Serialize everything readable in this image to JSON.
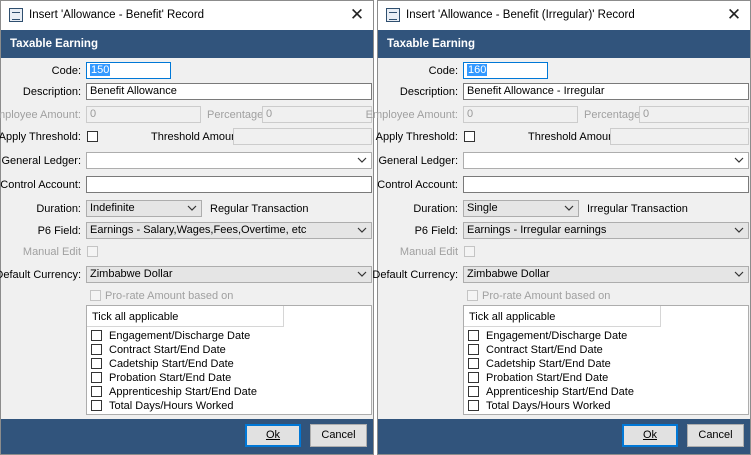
{
  "dialogs": [
    {
      "title": "Insert 'Allowance - Benefit' Record",
      "section": "Taxable Earning",
      "labels": {
        "code": "Code:",
        "description": "Description:",
        "employee_amount": "Employee Amount:",
        "percentage": "Percentage:",
        "apply_threshold": "Apply Threshold:",
        "threshold_amount": "Threshold Amount:",
        "general_ledger": "General Ledger:",
        "control_account": "Control Account:",
        "duration": "Duration:",
        "p6_field": "P6 Field:",
        "manual_edit": "Manual Edit",
        "default_currency": "Default Currency:",
        "pro_rate": "Pro-rate Amount based on"
      },
      "code": "150",
      "description": "Benefit Allowance",
      "employee_amount": "0",
      "percentage": "0",
      "threshold_amount": "",
      "general_ledger": "",
      "control_account": "",
      "duration": "Indefinite",
      "transaction_type": "Regular Transaction",
      "p6_field": "Earnings - Salary,Wages,Fees,Overtime, etc",
      "default_currency": "Zimbabwe Dollar",
      "tick_header": "Tick all applicable",
      "tick_items": [
        "Engagement/Discharge Date",
        "Contract Start/End Date",
        "Cadetship Start/End Date",
        "Probation Start/End Date",
        "Apprenticeship Start/End Date",
        "Total Days/Hours Worked"
      ],
      "ok_label": "Ok",
      "cancel_label": "Cancel"
    },
    {
      "title": "Insert 'Allowance - Benefit (Irregular)' Record",
      "section": "Taxable Earning",
      "labels": {
        "code": "Code:",
        "description": "Description:",
        "employee_amount": "Employee Amount:",
        "percentage": "Percentage:",
        "apply_threshold": "Apply Threshold:",
        "threshold_amount": "Threshold Amount:",
        "general_ledger": "General Ledger:",
        "control_account": "Control Account:",
        "duration": "Duration:",
        "p6_field": "P6 Field:",
        "manual_edit": "Manual Edit",
        "default_currency": "Default Currency:",
        "pro_rate": "Pro-rate Amount based on"
      },
      "code": "160",
      "description": "Benefit Allowance - Irregular",
      "employee_amount": "0",
      "percentage": "0",
      "threshold_amount": "",
      "general_ledger": "",
      "control_account": "",
      "duration": "Single",
      "transaction_type": "Irregular Transaction",
      "p6_field": "Earnings - Irregular earnings",
      "default_currency": "Zimbabwe Dollar",
      "tick_header": "Tick all applicable",
      "tick_items": [
        "Engagement/Discharge Date",
        "Contract Start/End Date",
        "Cadetship Start/End Date",
        "Probation Start/End Date",
        "Apprenticeship Start/End Date",
        "Total Days/Hours Worked"
      ],
      "ok_label": "Ok",
      "cancel_label": "Cancel"
    }
  ],
  "icons": {
    "app": "app-window-icon",
    "close": "close-icon",
    "dropdown": "chevron-down-icon"
  },
  "colors": {
    "banner": "#31547c",
    "dialog_bg": "#f0f0f0",
    "selection": "#3399ff",
    "focus_border": "#0078d7"
  }
}
